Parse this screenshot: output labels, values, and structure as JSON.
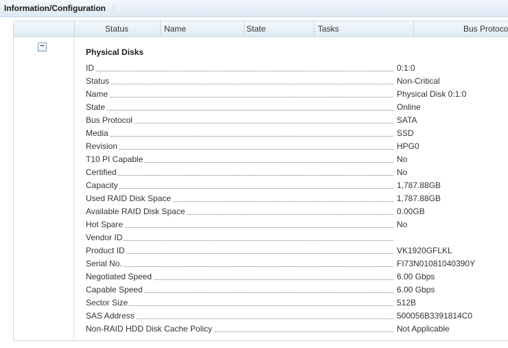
{
  "topbar": {
    "title": "Information/Configuration"
  },
  "table": {
    "columns": [
      "Status",
      "Name",
      "State",
      "Tasks",
      "Bus Protocol"
    ]
  },
  "section": {
    "collapse_symbol": "−",
    "title": "Physical Disks",
    "rows": [
      {
        "label": "ID",
        "value": "0:1:0"
      },
      {
        "label": "Status",
        "value": "Non-Critical"
      },
      {
        "label": "Name",
        "value": "Physical Disk 0:1:0"
      },
      {
        "label": "State",
        "value": "Online"
      },
      {
        "label": "Bus Protocol",
        "value": "SATA"
      },
      {
        "label": "Media",
        "value": "SSD"
      },
      {
        "label": "Revision",
        "value": "HPG0"
      },
      {
        "label": "T10 PI Capable",
        "value": "No"
      },
      {
        "label": "Certified",
        "value": "No"
      },
      {
        "label": "Capacity",
        "value": "1,787.88GB"
      },
      {
        "label": "Used RAID Disk Space",
        "value": "1,787.88GB"
      },
      {
        "label": "Available RAID Disk Space",
        "value": "0.00GB"
      },
      {
        "label": "Hot Spare",
        "value": "No"
      },
      {
        "label": "Vendor ID",
        "value": ""
      },
      {
        "label": "Product ID",
        "value": "VK1920GFLKL"
      },
      {
        "label": "Serial No.",
        "value": "FI73N01081040390Y"
      },
      {
        "label": "Negotiated Speed",
        "value": "6.00 Gbps"
      },
      {
        "label": "Capable Speed",
        "value": "6.00 Gbps"
      },
      {
        "label": "Sector Size",
        "value": "512B"
      },
      {
        "label": "SAS Address",
        "value": "500056B3391814C0"
      },
      {
        "label": "Non-RAID HDD Disk Cache Policy",
        "value": "Not Applicable"
      }
    ]
  }
}
